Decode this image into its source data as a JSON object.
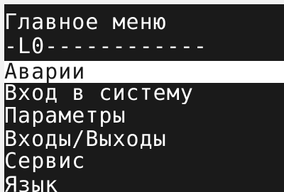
{
  "screen": {
    "title": "Главное меню",
    "level_line": "-L0------------",
    "menu_items": [
      {
        "label": "Аварии",
        "selected": true
      },
      {
        "label": "Вход в систему",
        "selected": false
      },
      {
        "label": "Параметры",
        "selected": false
      },
      {
        "label": "Входы/Выходы",
        "selected": false
      },
      {
        "label": "Сервис",
        "selected": false
      },
      {
        "label": "Язык",
        "selected": false
      }
    ]
  },
  "colors": {
    "screen_bg": "#1a1a1a",
    "text": "#ffffff",
    "highlight_bg": "#ffffff",
    "frame_bg": "#f2f2f2"
  }
}
